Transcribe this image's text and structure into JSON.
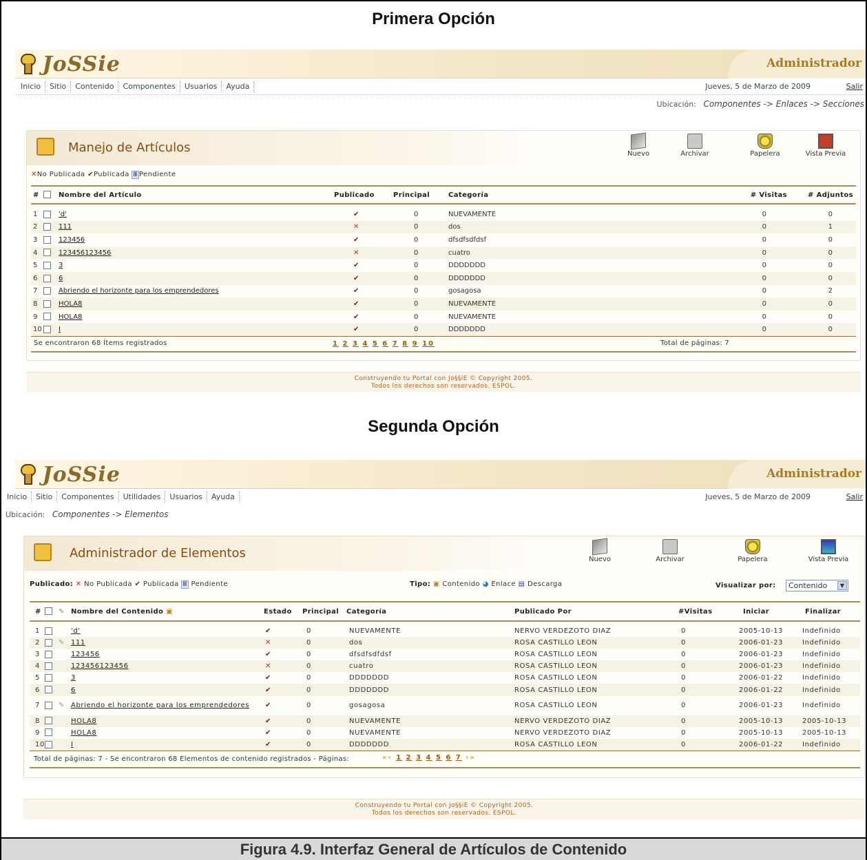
{
  "figure": {
    "title1": "Primera Opción",
    "title2": "Segunda Opción",
    "caption": "Figura 4.9. Interfaz General de Artículos de Contenido"
  },
  "opt1": {
    "admin_label": "Administrador",
    "menu": [
      "Inicio",
      "Sitio",
      "Contenido",
      "Componentes",
      "Usuarios",
      "Ayuda"
    ],
    "date": "Jueves, 5 de Marzo de 2009",
    "salir": "Salir",
    "ubic_label": "Ubicación:",
    "ubic_value": "Componentes -> Enlaces -> Secciones",
    "panel_title": "Manejo de Artículos",
    "tools": [
      "Nuevo",
      "Archivar",
      "Papelera",
      "Vista Previa"
    ],
    "legend": [
      "No Publicada",
      "Publicada",
      "Pendiente"
    ],
    "cols": [
      "#",
      "Nombre del Artículo",
      "Publicado",
      "Principal",
      "Categoría",
      "# Visitas",
      "# Adjuntos"
    ],
    "rows": [
      {
        "n": "1",
        "name": "'d'",
        "pub": "check",
        "prin": "0",
        "cat": "NUEVAMENTE",
        "vis": "0",
        "adj": "0"
      },
      {
        "n": "2",
        "name": "111",
        "pub": "x",
        "prin": "0",
        "cat": "dos",
        "vis": "0",
        "adj": "1"
      },
      {
        "n": "3",
        "name": "123456",
        "pub": "check",
        "prin": "0",
        "cat": "dfsdfsdfdsf",
        "vis": "0",
        "adj": "0"
      },
      {
        "n": "4",
        "name": "123456123456",
        "pub": "x",
        "prin": "0",
        "cat": "cuatro",
        "vis": "0",
        "adj": "0"
      },
      {
        "n": "5",
        "name": "3",
        "pub": "check",
        "prin": "0",
        "cat": "DDDDDDD",
        "vis": "0",
        "adj": "0"
      },
      {
        "n": "6",
        "name": "6",
        "pub": "check",
        "prin": "0",
        "cat": "DDDDDDD",
        "vis": "0",
        "adj": "0"
      },
      {
        "n": "7",
        "name": "Abriendo el horizonte para los emprendedores",
        "pub": "check",
        "prin": "0",
        "cat": "gosagosa",
        "vis": "0",
        "adj": "2"
      },
      {
        "n": "8",
        "name": "HOLA8",
        "pub": "check",
        "prin": "0",
        "cat": "NUEVAMENTE",
        "vis": "0",
        "adj": "0"
      },
      {
        "n": "9",
        "name": "HOLA8",
        "pub": "check",
        "prin": "0",
        "cat": "NUEVAMENTE",
        "vis": "0",
        "adj": "0"
      },
      {
        "n": "10",
        "name": "I",
        "pub": "check",
        "prin": "0",
        "cat": "DDDDDDD",
        "vis": "0",
        "adj": "0"
      }
    ],
    "found": "Se encontraron 68 Ítems registrados",
    "pages": [
      "1",
      "2",
      "3",
      "4",
      "5",
      "6",
      "7",
      "8",
      "9",
      "10"
    ],
    "total_pages": "Total de páginas: 7",
    "copy1": "Construyendo tu Portal con Jo§§iE © Copyright 2005.",
    "copy2": "Todos los derechos son reservados. ESPOL."
  },
  "opt2": {
    "admin_label": "Administrador",
    "menu": [
      "Inicio",
      "Sitio",
      "Componentes",
      "Utilidades",
      "Usuarios",
      "Ayuda"
    ],
    "date": "Jueves, 5 de Marzo de 2009",
    "salir": "Salir",
    "ubic_label": "Ubicación:",
    "ubic_value": "Componentes -> Elementos",
    "panel_title": "Administrador de Elementos",
    "tools": [
      "Nuevo",
      "Archivar",
      "Papelera",
      "Vista Previa"
    ],
    "publicado_label": "Publicado:",
    "legend": [
      "No Publicada",
      "Publicada",
      "Pendiente"
    ],
    "tipo_label": "Tipo:",
    "tipos": [
      "Contenido",
      "Enlace",
      "Descarga"
    ],
    "visualizar_label": "Visualizar por:",
    "visualizar_value": "Contenido",
    "cols": [
      "#",
      "Nombre del Contenido",
      "Estado",
      "Principal",
      "Categoría",
      "Publicado Por",
      "#Visitas",
      "Iniciar",
      "Finalizar"
    ],
    "rows": [
      {
        "n": "1",
        "name": "'d'",
        "est": "check",
        "prin": "0",
        "cat": "NUEVAMENTE",
        "por": "NERVO VERDEZOTO DIAZ",
        "vis": "0",
        "ini": "2005-10-13",
        "fin": "Indefinido"
      },
      {
        "n": "2",
        "name": "111",
        "est": "x",
        "prin": "0",
        "cat": "dos",
        "por": "ROSA CASTILLO LEON",
        "vis": "0",
        "ini": "2006-01-23",
        "fin": "Indefinido"
      },
      {
        "n": "3",
        "name": "123456",
        "est": "check",
        "prin": "0",
        "cat": "dfsdfsdfdsf",
        "por": "ROSA CASTILLO LEON",
        "vis": "0",
        "ini": "2006-01-23",
        "fin": "Indefinido"
      },
      {
        "n": "4",
        "name": "123456123456",
        "est": "x",
        "prin": "0",
        "cat": "cuatro",
        "por": "ROSA CASTILLO LEON",
        "vis": "0",
        "ini": "2006-01-23",
        "fin": "Indefinido"
      },
      {
        "n": "5",
        "name": "3",
        "est": "check",
        "prin": "0",
        "cat": "DDDDDDD",
        "por": "ROSA CASTILLO LEON",
        "vis": "0",
        "ini": "2006-01-22",
        "fin": "Indefinido"
      },
      {
        "n": "6",
        "name": "6",
        "est": "check",
        "prin": "0",
        "cat": "DDDDDDD",
        "por": "ROSA CASTILLO LEON",
        "vis": "0",
        "ini": "2006-01-22",
        "fin": "Indefinido"
      },
      {
        "n": "7",
        "name": "Abriendo el horizonte para los emprendedores",
        "est": "check",
        "prin": "0",
        "cat": "gosagosa",
        "por": "ROSA CASTILLO LEON",
        "vis": "0",
        "ini": "2006-01-23",
        "fin": "Indefinido"
      },
      {
        "n": "8",
        "name": "HOLA8",
        "est": "check",
        "prin": "0",
        "cat": "NUEVAMENTE",
        "por": "NERVO VERDEZOTO DIAZ",
        "vis": "0",
        "ini": "2005-10-13",
        "fin": "2005-10-13"
      },
      {
        "n": "9",
        "name": "HOLA8",
        "est": "check",
        "prin": "0",
        "cat": "NUEVAMENTE",
        "por": "NERVO VERDEZOTO DIAZ",
        "vis": "0",
        "ini": "2005-10-13",
        "fin": "2005-10-13"
      },
      {
        "n": "10",
        "name": "I",
        "est": "check",
        "prin": "0",
        "cat": "DDDDDDD",
        "por": "ROSA CASTILLO LEON",
        "vis": "0",
        "ini": "2006-01-22",
        "fin": "Indefinido"
      }
    ],
    "footer_text": "Total de páginas: 7  -  Se encontraron 68 Elementos de contenido registrados  - Páginas:",
    "pages": [
      "1",
      "2",
      "3",
      "4",
      "5",
      "6",
      "7"
    ],
    "copy1": "Construyendo tu Portal con Jo§§iE © Copyright 2005.",
    "copy2": "Todos los derechos son reservados. ESPOL."
  },
  "colors": {
    "accent": "#8a4c14",
    "x_mark": "#b2321c",
    "check_mark": "#7a1e0e",
    "page_link": "#9b5a0a"
  }
}
